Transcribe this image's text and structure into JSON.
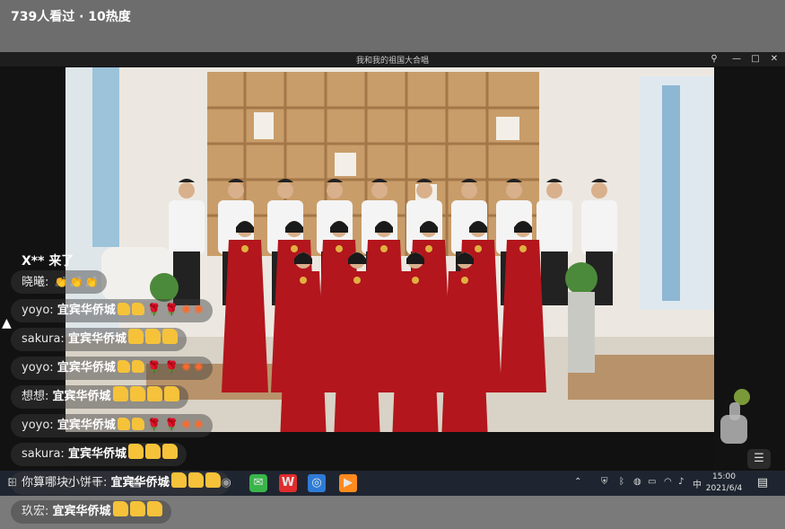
{
  "header": {
    "viewers_text": "739人看过 · 10热度"
  },
  "window": {
    "title": "我和我的祖国大合唱",
    "controls": {
      "pin": "⚲",
      "minimize": "—",
      "maximize": "□",
      "close": "✕"
    }
  },
  "chat": {
    "arrival": {
      "user": "X**",
      "text": "来了"
    },
    "messages": [
      {
        "user": "晓曦",
        "text": "",
        "emojis": [
          "clap",
          "clap",
          "clap"
        ]
      },
      {
        "user": "yoyo",
        "text": "宜宾华侨城",
        "emojis": [
          "thumb",
          "thumb",
          "rose",
          "rose",
          "firework",
          "firework"
        ]
      },
      {
        "user": "sakura",
        "text": "宜宾华侨城",
        "emojis": [
          "thumbbig",
          "thumbbig",
          "thumbbig"
        ]
      },
      {
        "user": "yoyo",
        "text": "宜宾华侨城",
        "emojis": [
          "thumb",
          "thumb",
          "rose",
          "rose",
          "firework",
          "firework"
        ]
      },
      {
        "user": "想想",
        "text": "宜宾华侨城",
        "emojis": [
          "thumbbig",
          "thumbbig",
          "thumbbig",
          "thumbbig"
        ]
      },
      {
        "user": "yoyo",
        "text": "宜宾华侨城",
        "emojis": [
          "thumb",
          "thumb",
          "rose",
          "rose",
          "firework",
          "firework"
        ]
      },
      {
        "user": "sakura",
        "text": "宜宾华侨城",
        "emojis": [
          "thumbbig",
          "thumbbig",
          "thumbbig"
        ]
      },
      {
        "user": "你算哪块小饼干",
        "text": "宜宾华侨城",
        "emojis": [
          "thumbbig",
          "thumbbig",
          "thumbbig"
        ]
      },
      {
        "user": "玖宏",
        "text": "宜宾华侨城",
        "emojis": [
          "thumbbig",
          "thumbbig",
          "thumbbig"
        ]
      }
    ]
  },
  "taskbar": {
    "start_icon": "windows-icon",
    "apps": [
      "search-icon",
      "cortana-icon",
      "taskview-icon",
      "store-icon",
      "edge-icon",
      "browser360-icon",
      "wechat-icon",
      "wps-icon",
      "browser-icon",
      "media-icon"
    ],
    "tray": {
      "ime": "中",
      "time": "15:00",
      "date": "2021/6/4"
    }
  },
  "colors": {
    "dress": "#b3161c",
    "shirt": "#f4f4f4",
    "shelf": "#c99d6a"
  }
}
